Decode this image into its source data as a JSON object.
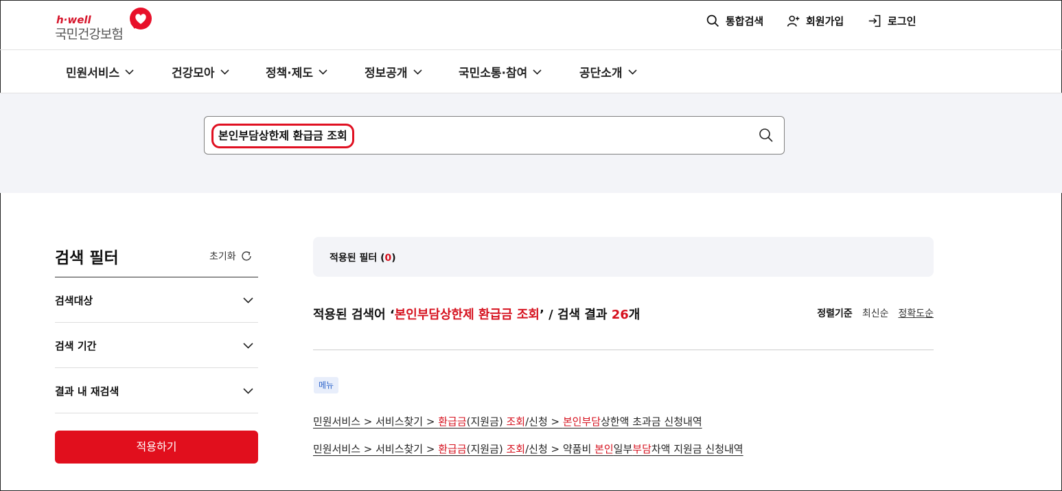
{
  "header": {
    "logo_sub": "h·well",
    "logo_main": "국민건강보험",
    "util": {
      "search": "통합검색",
      "signup": "회원가입",
      "login": "로그인"
    }
  },
  "gnb": {
    "items": [
      "민원서비스",
      "건강모아",
      "정책·제도",
      "정보공개",
      "국민소통·참여",
      "공단소개"
    ]
  },
  "search": {
    "query": "본인부담상한제 환급금 조회"
  },
  "filter": {
    "title": "검색 필터",
    "reset": "초기화",
    "rows": [
      "검색대상",
      "검색 기간",
      "결과 내 재검색"
    ],
    "apply": "적용하기"
  },
  "results": {
    "applied_label": "적용된 필터 (",
    "applied_count": "0",
    "applied_close": ")",
    "summary_prefix": "적용된 검색어 ‘",
    "summary_query": "본인부담상한제 환급금 조회",
    "summary_mid": "’ / 검색 결과 ",
    "summary_count": "26",
    "summary_suffix": "개",
    "sort_label": "정렬기준",
    "sort_options": [
      "최신순",
      "정확도순"
    ],
    "category_tag": "메뉴",
    "links": [
      [
        {
          "t": "민원서비스 > 서비스찾기 > ",
          "hl": false
        },
        {
          "t": "환급금",
          "hl": true
        },
        {
          "t": "(지원금) ",
          "hl": false
        },
        {
          "t": "조회",
          "hl": true
        },
        {
          "t": "/신청 > ",
          "hl": false
        },
        {
          "t": "본인부담",
          "hl": true
        },
        {
          "t": "상한액 초과금 신청내역",
          "hl": false
        }
      ],
      [
        {
          "t": "민원서비스 > 서비스찾기 > ",
          "hl": false
        },
        {
          "t": "환급금",
          "hl": true
        },
        {
          "t": "(지원금) ",
          "hl": false
        },
        {
          "t": "조회",
          "hl": true
        },
        {
          "t": "/신청 > 약품비 ",
          "hl": false
        },
        {
          "t": "본인",
          "hl": true
        },
        {
          "t": "일부",
          "hl": false
        },
        {
          "t": "부담",
          "hl": true
        },
        {
          "t": "차액 지원금 신청내역",
          "hl": false
        }
      ]
    ]
  },
  "colors": {
    "accent": "#e10f1d",
    "highlight": "#d6111e",
    "band": "#f3f4f8"
  }
}
